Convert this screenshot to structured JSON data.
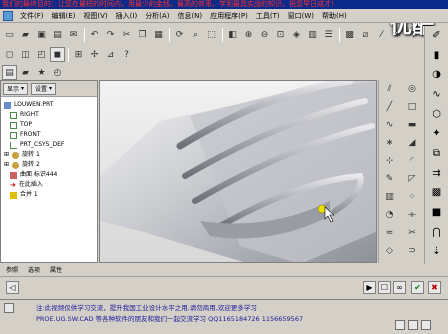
{
  "banner": {
    "text": "我们的最终目的：让您在最短的时间内，用最少的金钱，最高的效率，学到最具实战的知识，祝您早日成才！"
  },
  "watermark": {
    "text": "优酷"
  },
  "menu": {
    "items": [
      "文件(F)",
      "编辑(E)",
      "视图(V)",
      "插入(I)",
      "分析(A)",
      "信息(N)",
      "应用程序(P)",
      "工具(T)",
      "窗口(W)",
      "帮助(H)"
    ]
  },
  "left_panel": {
    "show_label": "显示",
    "settings_label": "设置",
    "tree": [
      {
        "label": "LOUWEN.PRT",
        "icon": "part-icon"
      },
      {
        "label": "RIGHT",
        "icon": "plane-icon"
      },
      {
        "label": "TOP",
        "icon": "plane-icon"
      },
      {
        "label": "FRONT",
        "icon": "plane-icon"
      },
      {
        "label": "PRT_CSYS_DEF",
        "icon": "csys-icon"
      },
      {
        "label": "旋转 1",
        "icon": "revolve-icon"
      },
      {
        "label": "旋转 2",
        "icon": "revolve-icon"
      },
      {
        "label": "曲面 标识444",
        "icon": "surface-icon"
      },
      {
        "label": "在此插入",
        "icon": "insert-arrow-icon"
      },
      {
        "label": "合并 1",
        "icon": "merge-icon"
      }
    ]
  },
  "tabs": [
    "参照",
    "选项",
    "属性"
  ],
  "status": {
    "line1": "注:此视频仅供学习交流，提升我国工业设计水平之用,请勿商用,欢迎更多学习",
    "line2": "PROE.UG.SW.CAD 等各种软件的朋友和我们一起交流学习 QQ1165184726  1156659567",
    "line3": ""
  },
  "colors": {
    "banner_bg": "#0a2a8a",
    "banner_text": "#ff3030",
    "status_text": "#1a1a9a"
  }
}
